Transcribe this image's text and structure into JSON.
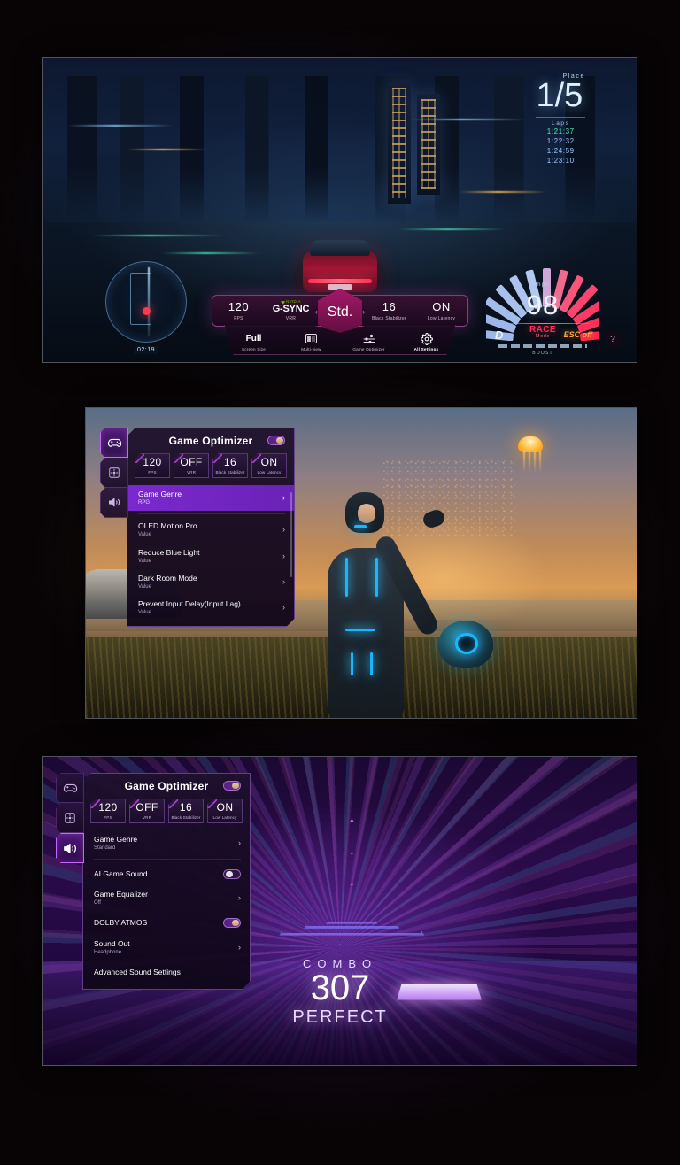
{
  "panels": [
    {
      "id": "racing-tv",
      "scene": "night-city-racing",
      "hud": {
        "place_label": "Place",
        "place_value": "1/5",
        "laps_label": "Laps",
        "lap_times": [
          "1:21:37",
          "1:22:32",
          "1:24:59",
          "1:23:10"
        ],
        "minimap_time": "02:19",
        "speed_unit": "mph",
        "speed_value": "98",
        "mode_main": "RACE",
        "mode_sub": "Mode",
        "gear": "D",
        "esc": "ESC off",
        "boost_label": "BOOST"
      },
      "gamebar": {
        "stats": [
          {
            "value": "120",
            "label": "FPS"
          },
          {
            "value": "G-SYNC",
            "label": "VRR",
            "brand": "NVIDIA"
          },
          {
            "value": "16",
            "label": "Black Stabilizer"
          },
          {
            "value": "ON",
            "label": "Low Latency"
          }
        ],
        "preset": "Std.",
        "arrow_left": "‹",
        "arrow_right": "›",
        "menu": [
          {
            "value": "Full",
            "label": "Screen Size",
            "icon": "screen-size-icon",
            "active": false
          },
          {
            "value": "",
            "label": "Multi-view",
            "icon": "multi-view-icon",
            "active": false
          },
          {
            "value": "",
            "label": "Game Optimizer",
            "icon": "sliders-icon",
            "active": false
          },
          {
            "value": "",
            "label": "All Settings",
            "icon": "gear-icon",
            "active": true
          }
        ],
        "help": "?"
      }
    },
    {
      "id": "game-optimizer-picture-tv",
      "scene": "sunset-character",
      "menu": {
        "title": "Game Optimizer",
        "power_toggle": "on",
        "rail": [
          {
            "icon": "gamepad-icon",
            "name": "game-tab",
            "active": true
          },
          {
            "icon": "picture-icon",
            "name": "picture-tab",
            "active": false
          },
          {
            "icon": "speaker-icon",
            "name": "sound-tab",
            "active": false
          }
        ],
        "chips": [
          {
            "value": "120",
            "label": "FPS"
          },
          {
            "value": "OFF",
            "label": "VRR"
          },
          {
            "value": "16",
            "label": "Black Stabilizer"
          },
          {
            "value": "ON",
            "label": "Low Latency"
          }
        ],
        "rows": [
          {
            "title": "Game Genre",
            "value": "RPG",
            "control": "chevron",
            "selected": true
          },
          {
            "title": "OLED Motion Pro",
            "value": "Value",
            "control": "chevron",
            "selected": false
          },
          {
            "title": "Reduce Blue Light",
            "value": "Value",
            "control": "chevron",
            "selected": false
          },
          {
            "title": "Dark Room Mode",
            "value": "Value",
            "control": "chevron",
            "selected": false
          },
          {
            "title": "Prevent Input Delay(Input Lag)",
            "value": "Value",
            "control": "chevron",
            "selected": false
          }
        ]
      }
    },
    {
      "id": "game-optimizer-sound-tv",
      "scene": "rhythm-game",
      "overlay": {
        "combo_label": "COMBO",
        "combo_value": "307",
        "combo_rank": "PERFECT"
      },
      "menu": {
        "title": "Game Optimizer",
        "power_toggle": "on",
        "rail": [
          {
            "icon": "gamepad-icon",
            "name": "game-tab",
            "active": false
          },
          {
            "icon": "picture-icon",
            "name": "picture-tab",
            "active": false
          },
          {
            "icon": "speaker-icon",
            "name": "sound-tab",
            "active": true
          }
        ],
        "chips": [
          {
            "value": "120",
            "label": "FPS"
          },
          {
            "value": "OFF",
            "label": "VRR"
          },
          {
            "value": "16",
            "label": "Black Stabilizer"
          },
          {
            "value": "ON",
            "label": "Low Latency"
          }
        ],
        "rows": [
          {
            "title": "Game Genre",
            "value": "Standard",
            "control": "chevron",
            "selected": false
          },
          {
            "title": "AI Game Sound",
            "value": "",
            "control": "toggle-off",
            "selected": false
          },
          {
            "title": "Game Equalizer",
            "value": "Off",
            "control": "chevron",
            "selected": false
          },
          {
            "title": "DOLBY ATMOS",
            "value": "",
            "control": "toggle-on",
            "selected": false
          },
          {
            "title": "Sound Out",
            "value": "Headphone",
            "control": "chevron",
            "selected": false
          },
          {
            "title": "Advanced Sound Settings",
            "value": "",
            "control": "none",
            "selected": false
          }
        ]
      }
    }
  ],
  "colors": {
    "accent_purple": "#a84bd8",
    "accent_magenta": "#d24bd8",
    "nvidia_green": "#76b900",
    "race_red": "#ff2b4e",
    "esc_orange": "#ffa23a",
    "selected_row": "#7b29cf"
  }
}
